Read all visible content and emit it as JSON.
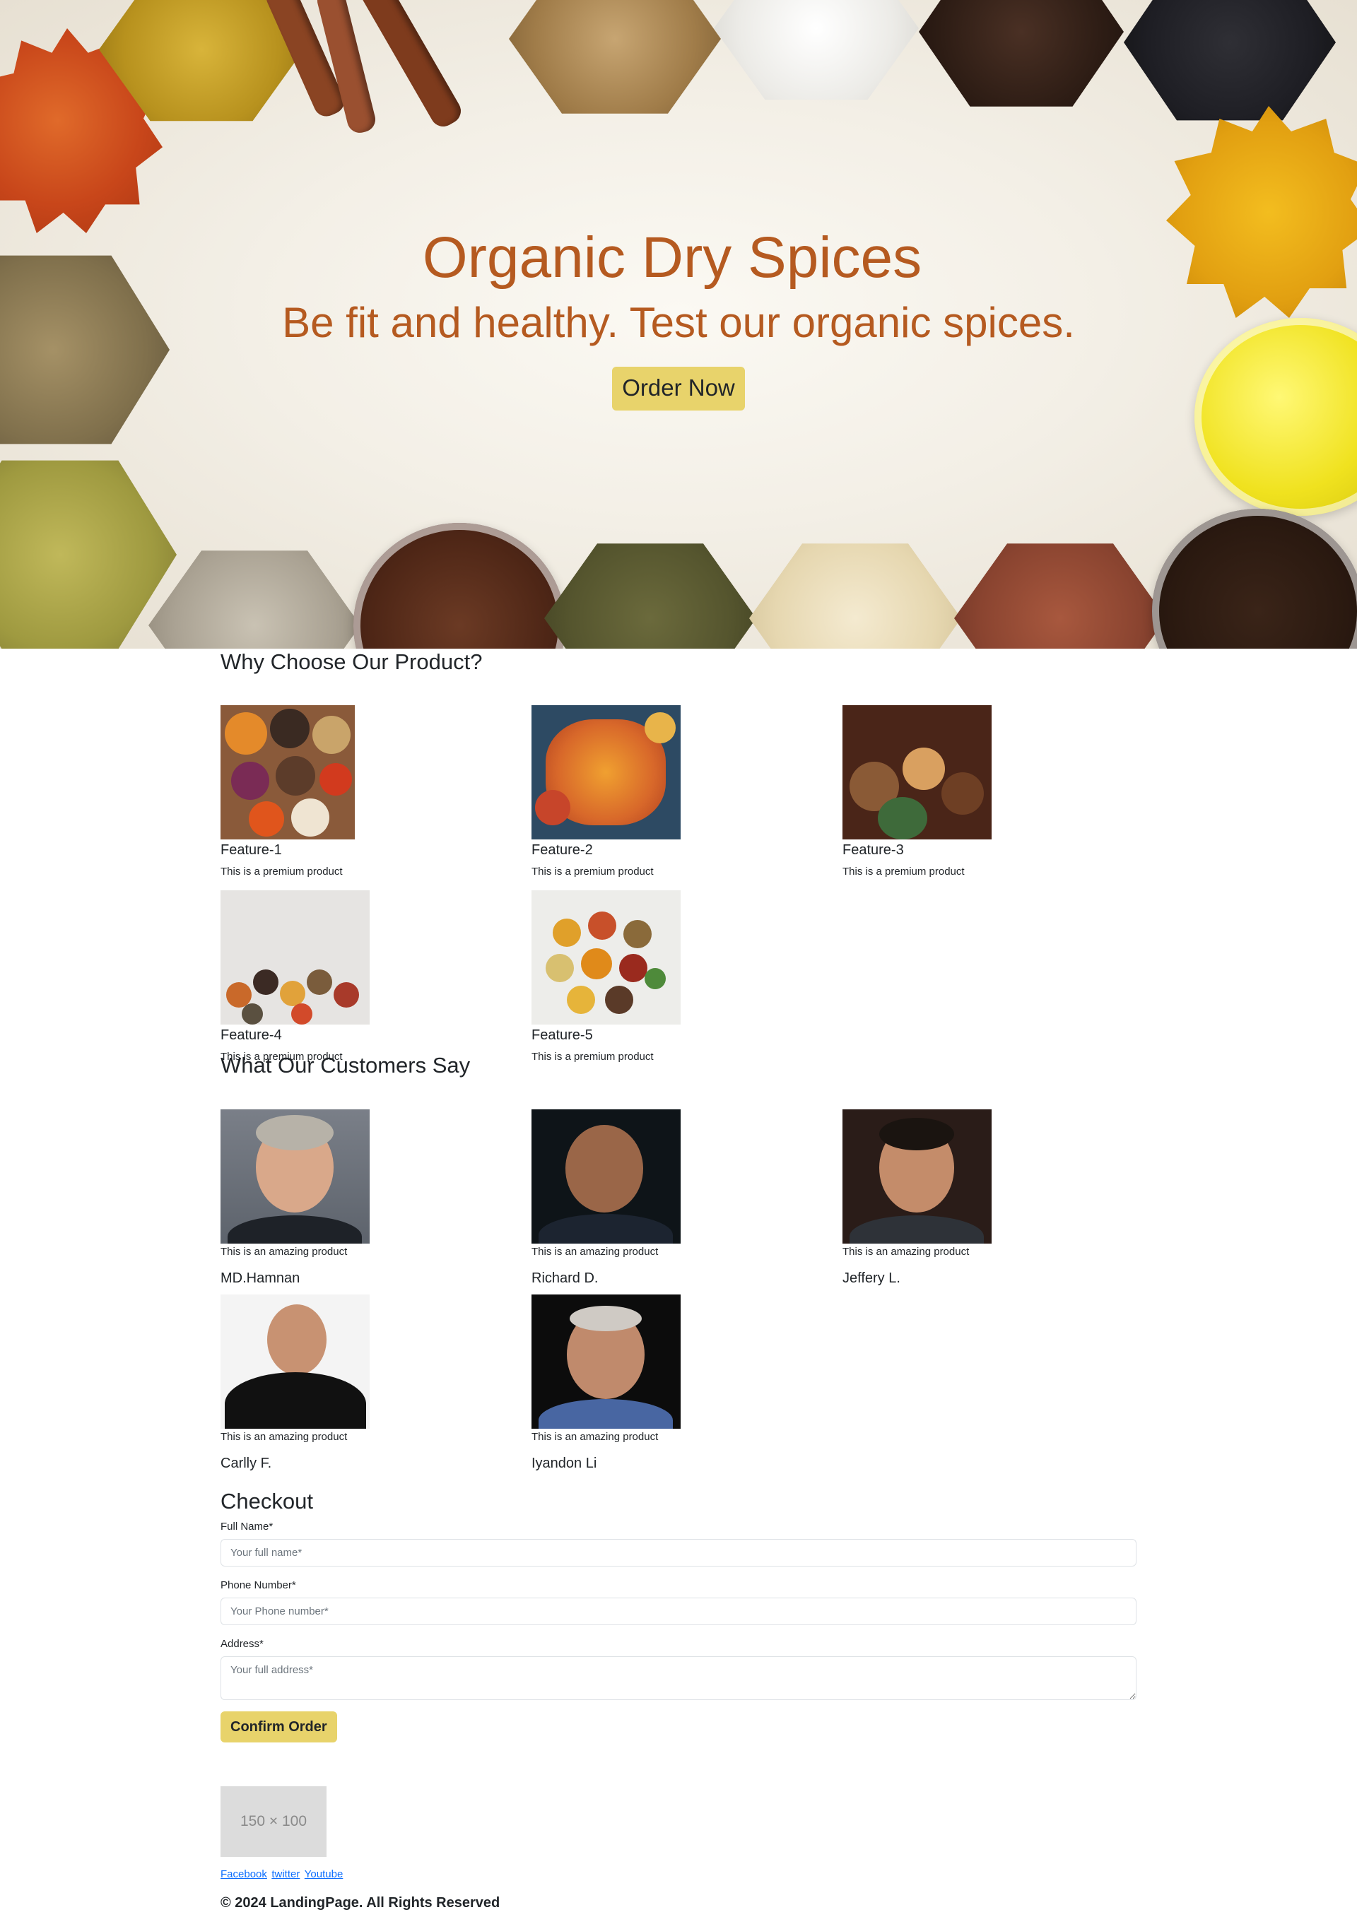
{
  "hero": {
    "title": "Organic Dry Spices",
    "subtitle": "Be fit and healthy. Test our organic spices.",
    "cta_label": "Order Now"
  },
  "features": {
    "heading": "Why Choose Our Product?",
    "items": [
      {
        "title": "Feature-1",
        "description": "This is a premium product"
      },
      {
        "title": "Feature-2",
        "description": "This is a premium product"
      },
      {
        "title": "Feature-3",
        "description": "This is a premium product"
      },
      {
        "title": "Feature-4",
        "description": "This is a premium product"
      },
      {
        "title": "Feature-5",
        "description": "This is a premium product"
      }
    ]
  },
  "testimonials": {
    "heading": "What Our Customers Say",
    "items": [
      {
        "quote": "This is an amazing product",
        "name": "MD.Hamnan"
      },
      {
        "quote": "This is an amazing product",
        "name": "Richard D."
      },
      {
        "quote": "This is an amazing product",
        "name": "Jeffery L."
      },
      {
        "quote": "This is an amazing product",
        "name": "Carlly F."
      },
      {
        "quote": "This is an amazing product",
        "name": "Iyandon Li"
      }
    ]
  },
  "checkout": {
    "heading": "Checkout",
    "full_name": {
      "label": "Full Name*",
      "placeholder": "Your full name*"
    },
    "phone": {
      "label": "Phone Number*",
      "placeholder": "Your Phone number*"
    },
    "address": {
      "label": "Address*",
      "placeholder": "Your full address*"
    },
    "submit_label": "Confirm Order"
  },
  "footer": {
    "logo_placeholder": "150 × 100",
    "links": [
      "Facebook",
      "twitter",
      "Youtube"
    ],
    "copyright": "© 2024 LandingPage. All Rights Reserved"
  },
  "colors": {
    "brand_text": "#b55a20",
    "button_yellow": "#e8d36b",
    "link_blue": "#0d6efd"
  }
}
